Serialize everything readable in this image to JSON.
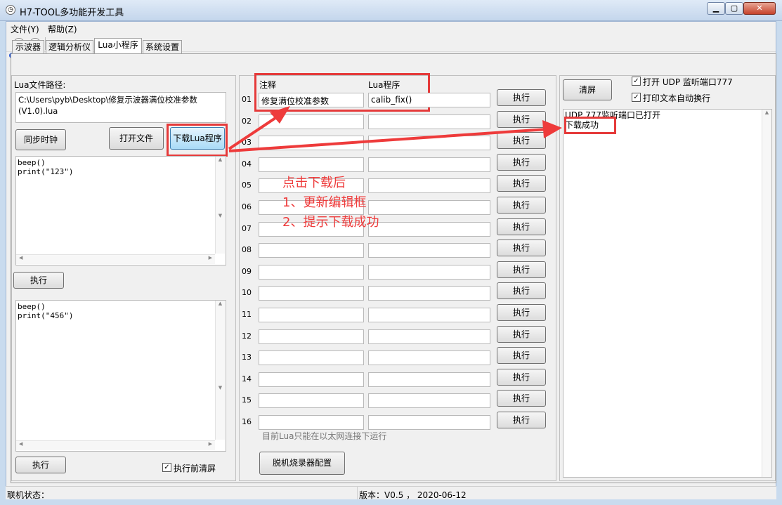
{
  "window": {
    "title": "H7-TOOL多功能开发工具",
    "min": "▁",
    "max": "▢",
    "close": "✕"
  },
  "menu": [
    "文件(Y)",
    "帮助(Z)"
  ],
  "tabs": [
    "示波器",
    "逻辑分析仪",
    "Lua小程序",
    "系统设置"
  ],
  "left": {
    "path_label": "Lua文件路径:",
    "path_line1": "C:\\Users\\pyb\\Desktop\\修复示波器满位校准参数",
    "path_line2": "(V1.0).lua",
    "sync_clock": "同步时钟",
    "open_file": "打开文件",
    "download": "下载Lua程序",
    "editor1": "beep()\nprint(\"123\")",
    "run1": "执行",
    "editor2": "beep()\nprint(\"456\")",
    "run2": "执行",
    "clear_before_run": "执行前清屏"
  },
  "middle": {
    "header_comment": "注释",
    "header_lua": "Lua程序",
    "rows": [
      {
        "num": "01",
        "comment": "修复满位校准参数",
        "lua": "calib_fix()",
        "btn": "执行"
      },
      {
        "num": "02",
        "comment": "",
        "lua": "",
        "btn": "执行"
      },
      {
        "num": "03",
        "comment": "",
        "lua": "",
        "btn": "执行"
      },
      {
        "num": "04",
        "comment": "",
        "lua": "",
        "btn": "执行"
      },
      {
        "num": "05",
        "comment": "",
        "lua": "",
        "btn": "执行"
      },
      {
        "num": "06",
        "comment": "",
        "lua": "",
        "btn": "执行"
      },
      {
        "num": "07",
        "comment": "",
        "lua": "",
        "btn": "执行"
      },
      {
        "num": "08",
        "comment": "",
        "lua": "",
        "btn": "执行"
      },
      {
        "num": "09",
        "comment": "",
        "lua": "",
        "btn": "执行"
      },
      {
        "num": "10",
        "comment": "",
        "lua": "",
        "btn": "执行"
      },
      {
        "num": "11",
        "comment": "",
        "lua": "",
        "btn": "执行"
      },
      {
        "num": "12",
        "comment": "",
        "lua": "",
        "btn": "执行"
      },
      {
        "num": "13",
        "comment": "",
        "lua": "",
        "btn": "执行"
      },
      {
        "num": "14",
        "comment": "",
        "lua": "",
        "btn": "执行"
      },
      {
        "num": "15",
        "comment": "",
        "lua": "",
        "btn": "执行"
      },
      {
        "num": "16",
        "comment": "",
        "lua": "",
        "btn": "执行"
      }
    ],
    "note": "目前Lua只能在以太网连接下运行",
    "offline_config": "脱机烧录器配置"
  },
  "right": {
    "clear": "清屏",
    "udp_listen": "打开 UDP 监听端口777",
    "auto_wrap": "打印文本自动换行",
    "log_line1": "UDP 777监听端口已打开",
    "log_line2": "下载成功"
  },
  "annotation": {
    "line1": "点击下载后",
    "line2": "1、更新编辑框",
    "line3": "2、提示下载成功",
    "color": "#ee3b3b"
  },
  "status": {
    "conn_label": "联机状态：",
    "version": "版本：V0.5 ， 2020-06-12"
  }
}
